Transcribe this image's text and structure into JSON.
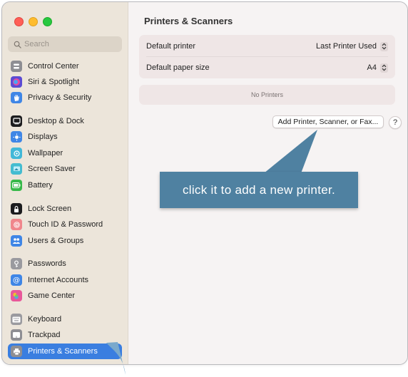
{
  "window": {
    "traffic_lights": [
      "close",
      "minimize",
      "maximize"
    ]
  },
  "sidebar": {
    "search_placeholder": "Search",
    "items": [
      {
        "label": "Control Center",
        "icon": "control-center-icon",
        "color": "#8e8e93"
      },
      {
        "label": "Siri & Spotlight",
        "icon": "siri-icon",
        "color": "#5b4bd3"
      },
      {
        "label": "Privacy & Security",
        "icon": "hand-icon",
        "color": "#3f86e6"
      },
      {
        "label": "Desktop & Dock",
        "icon": "desktop-icon",
        "color": "#1c1c1e"
      },
      {
        "label": "Displays",
        "icon": "sun-icon",
        "color": "#3f86e6"
      },
      {
        "label": "Wallpaper",
        "icon": "wallpaper-icon",
        "color": "#41b8d8"
      },
      {
        "label": "Screen Saver",
        "icon": "screen-saver-icon",
        "color": "#44bcd0"
      },
      {
        "label": "Battery",
        "icon": "battery-icon",
        "color": "#38b94a"
      },
      {
        "label": "Lock Screen",
        "icon": "lock-icon",
        "color": "#1c1c1e"
      },
      {
        "label": "Touch ID & Password",
        "icon": "fingerprint-icon",
        "color": "#f0868c"
      },
      {
        "label": "Users & Groups",
        "icon": "users-icon",
        "color": "#3f86e6"
      },
      {
        "label": "Passwords",
        "icon": "key-icon",
        "color": "#9a9a9f"
      },
      {
        "label": "Internet Accounts",
        "icon": "at-icon",
        "color": "#3f86e6"
      },
      {
        "label": "Game Center",
        "icon": "game-center-icon",
        "color": "#e8589a"
      },
      {
        "label": "Keyboard",
        "icon": "keyboard-icon",
        "color": "#9a9a9f"
      },
      {
        "label": "Trackpad",
        "icon": "trackpad-icon",
        "color": "#8e8e93"
      },
      {
        "label": "Printers & Scanners",
        "icon": "printer-icon",
        "color": "#8e8e93",
        "active": true
      }
    ]
  },
  "main": {
    "title": "Printers & Scanners",
    "settings": [
      {
        "label": "Default printer",
        "value": "Last Printer Used"
      },
      {
        "label": "Default paper size",
        "value": "A4"
      }
    ],
    "no_printers_text": "No Printers",
    "add_button_label": "Add Printer, Scanner, or Fax...",
    "help_button_label": "?"
  },
  "annotation": {
    "callout_text": "click it to add a new printer.",
    "callout_color": "#4f81a1",
    "arrow_color": "#7aa9cc"
  },
  "colors": {
    "accent": "#3a7ee0",
    "sidebar_bg": "#ece5da",
    "content_bg": "#f6f3f3"
  }
}
